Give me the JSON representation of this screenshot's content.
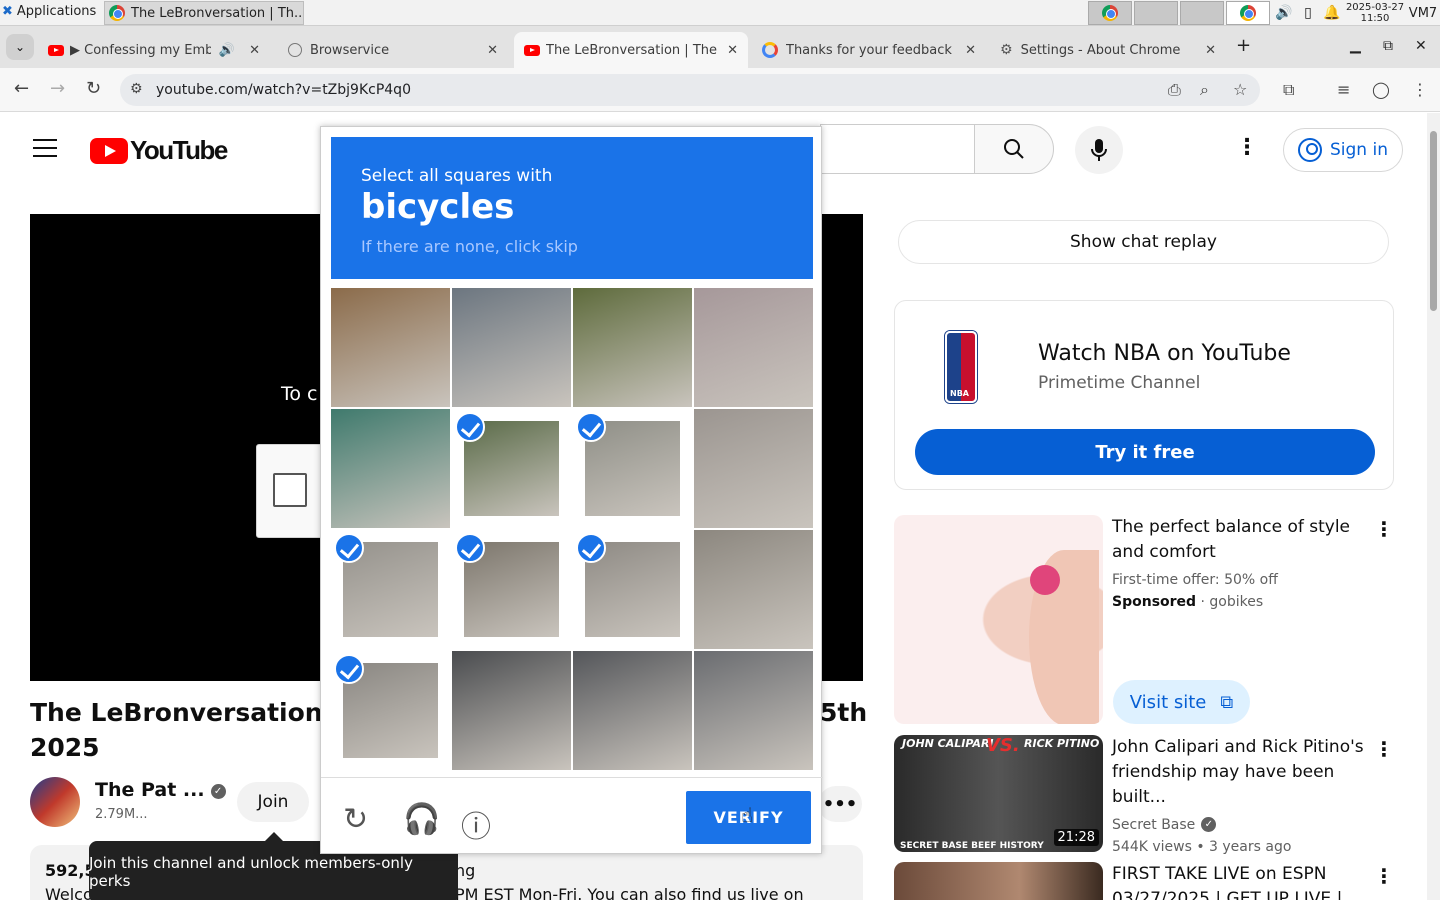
{
  "system": {
    "apps_label": "Applications",
    "task_title": "The LeBronversation | Th...",
    "clock_date": "2025-03-27",
    "clock_time": "11:50",
    "vm_label": "VM7"
  },
  "tabs": [
    {
      "title": "▶ Confessing my Emba",
      "icon": "youtube-icon"
    },
    {
      "title": "Browservice",
      "icon": "globe-icon"
    },
    {
      "title": "The LeBronversation | The",
      "icon": "youtube-icon",
      "active": true
    },
    {
      "title": "Thanks for your feedback",
      "icon": "google-icon"
    },
    {
      "title": "Settings - About Chrome",
      "icon": "gear-icon"
    }
  ],
  "address": {
    "url": "youtube.com/watch?v=tZbj9KcP4q0"
  },
  "youtube": {
    "logo_text": "YouTube",
    "sign_in": "Sign in",
    "player_text": "To c",
    "video_title_line1": "The LeBronversation | The",
    "video_title_right": "5th",
    "video_title_line2": "2025",
    "channel_name": "The Pat ...",
    "channel_subs": "2.79M...",
    "join_label": "Join",
    "more_label": "•••",
    "desc_views": "592,5",
    "desc_line2": "Welco",
    "desc_right1": "ng",
    "desc_right2": "PM EST Mon-Fri. You can also find us live on",
    "tooltip": "Join this channel and unlock members-only perks",
    "show_chat_replay": "Show chat replay",
    "nba_title": "Watch NBA on YouTube",
    "nba_sub": "Primetime Channel",
    "nba_logo_text": "NBA",
    "try_free": "Try it free",
    "rec1_title": "The perfect balance of style and comfort",
    "rec1_offer": "First-time offer: 50% off",
    "rec1_sponsored": "Sponsored",
    "rec1_sponsor_name": "gobikes",
    "visit_site": "Visit site",
    "rec2_title": "John Calipari and Rick Pitino's friendship may have been built...",
    "rec2_channel": "Secret Base",
    "rec2_meta": "544K views • 3 years ago",
    "rec2_thumb_left": "JOHN CALIPARI",
    "rec2_thumb_vs": "VS.",
    "rec2_thumb_right": "RICK PITINO",
    "rec2_thumb_foot": "SECRET BASE   BEEF HISTORY",
    "rec2_duration": "21:28",
    "rec3_title": "FIRST TAKE LIVE on ESPN 03/27/2025 | GET UP LIVE |"
  },
  "captcha": {
    "prompt_line1": "Select all squares with",
    "prompt_target": "bicycles",
    "prompt_hint": "If there are none, click skip",
    "verify_label": "VERIFY",
    "tiles": [
      {
        "selected": false,
        "bg": "#8b6b4a"
      },
      {
        "selected": false,
        "bg": "#6c7680"
      },
      {
        "selected": false,
        "bg": "#5e6b3c"
      },
      {
        "selected": false,
        "bg": "#a6989a"
      },
      {
        "selected": false,
        "bg": "#3f7a6d"
      },
      {
        "selected": true,
        "bg": "#5a6b48"
      },
      {
        "selected": true,
        "bg": "#8f8f87"
      },
      {
        "selected": false,
        "bg": "#9b9590"
      },
      {
        "selected": true,
        "bg": "#95928c"
      },
      {
        "selected": true,
        "bg": "#7c766c"
      },
      {
        "selected": true,
        "bg": "#8e8a84"
      },
      {
        "selected": false,
        "bg": "#8c877f"
      },
      {
        "selected": true,
        "bg": "#8a8782"
      },
      {
        "selected": false,
        "bg": "#4a4c4f"
      },
      {
        "selected": false,
        "bg": "#54565a"
      },
      {
        "selected": false,
        "bg": "#6a6c70"
      }
    ]
  }
}
